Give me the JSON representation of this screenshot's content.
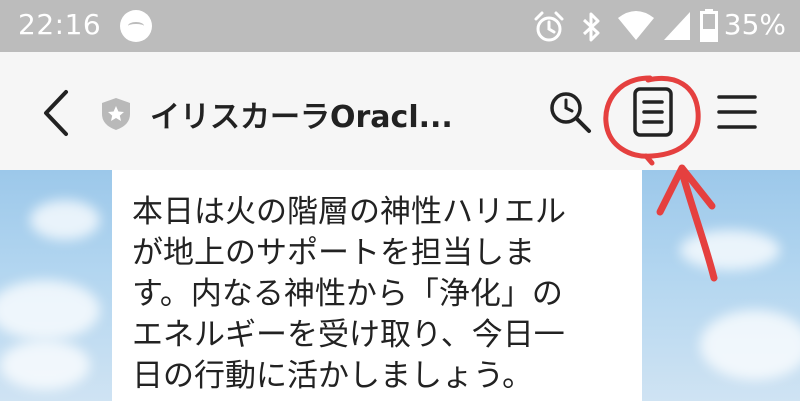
{
  "status_bar": {
    "time": "22:16",
    "battery_percent": "35%",
    "icons": [
      "alarm-icon",
      "bluetooth-icon",
      "wifi-icon",
      "signal-icon",
      "battery-icon"
    ]
  },
  "header": {
    "title": "イリスカーラOracl...",
    "icons": [
      "back-arrow-icon",
      "shield-icon",
      "search-icon",
      "notes-icon",
      "menu-icon"
    ]
  },
  "message": {
    "text": "本日は火の階層の神性ハリエル\nが地上のサポートを担当しま\nす。内なる神性から「浄化」の\nエネルギーを受け取り、今日一\n日の行動に活かしましょう。"
  },
  "colors": {
    "status_bar_bg": "#bcbcbc",
    "header_bg": "#f6f6f6",
    "annotation": "#e5403f",
    "sky": "#9cc8ea"
  }
}
